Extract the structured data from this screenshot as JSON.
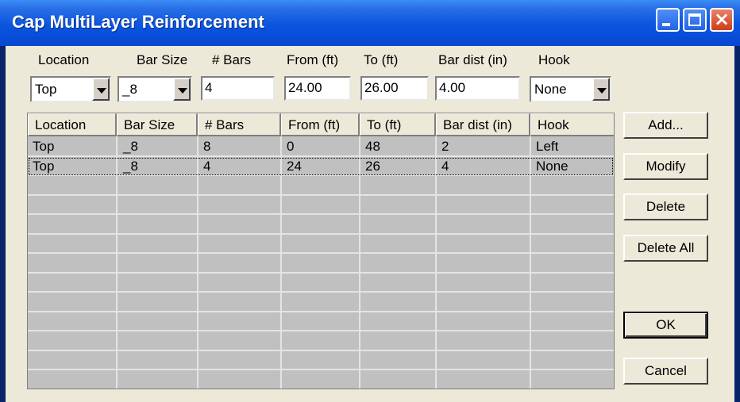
{
  "window": {
    "title": "Cap MultiLayer Reinforcement"
  },
  "labels": {
    "location": "Location",
    "bar_size": "Bar Size",
    "num_bars": "# Bars",
    "from": "From (ft)",
    "to": "To (ft)",
    "bar_dist": "Bar dist (in)",
    "hook": "Hook"
  },
  "inputs": {
    "location": "Top",
    "bar_size": "_8",
    "num_bars": "4",
    "from": "24.00",
    "to": "26.00",
    "bar_dist": "4.00",
    "hook": "None"
  },
  "table": {
    "headers": [
      "Location",
      "Bar Size",
      "# Bars",
      "From (ft)",
      "To (ft)",
      "Bar dist (in)",
      "Hook"
    ],
    "rows": [
      [
        "Top",
        "_8",
        "8",
        "0",
        "48",
        "2",
        "Left"
      ],
      [
        "Top",
        "_8",
        "4",
        "24",
        "26",
        "4",
        "None"
      ]
    ]
  },
  "buttons": {
    "add": "Add...",
    "modify": "Modify",
    "delete": "Delete",
    "delete_all": "Delete All",
    "ok": "OK",
    "cancel": "Cancel"
  },
  "colors": {
    "title_bar": "#0a55e0",
    "dialog_bg": "#ece9d8",
    "grid_bg": "#c0c0c0",
    "close_button": "#cf3d1a"
  }
}
